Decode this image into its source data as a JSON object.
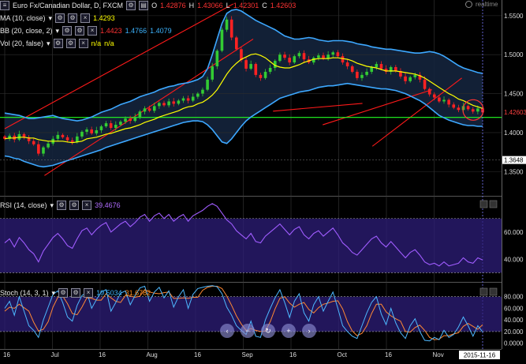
{
  "header": {
    "symbol": "Euro Fx/Canadian Dollar, D, FXCM",
    "o_label": "O",
    "o_value": "1.42876",
    "h_label": "H",
    "h_value": "1.43066",
    "l_label": "L",
    "l_value": "1.42301",
    "c_label": "C",
    "c_value": "1.42603",
    "realtime_label": "realtime"
  },
  "indicators": {
    "ma": {
      "label": "MA (10, close)",
      "value": "1.4293"
    },
    "bb": {
      "label": "BB (20, close, 2)",
      "v1": "1.4423",
      "v2": "1.4766",
      "v3": "1.4079"
    },
    "vol": {
      "label": "Vol (20, false)",
      "v1": "n/a",
      "v2": "n/a"
    },
    "rsi": {
      "label": "RSI (14, close)",
      "value": "39.4676"
    },
    "stoch": {
      "label": "Stoch (14, 3, 1)",
      "v1": "19.5034",
      "v2": "31.6782"
    }
  },
  "colors": {
    "background": "#000000",
    "up_candle": "#33cc33",
    "down_candle": "#ff2222",
    "ma": "#ffff00",
    "band": "#3da8ff",
    "band_fill": "#14243c",
    "trend": "#ff1a1a",
    "support": "#22ff22",
    "rsi": "#a05cff",
    "stoch_k": "#4db8ff",
    "stoch_d": "#ff8833",
    "panel_fill": "#2e1e7a"
  },
  "chart_data": [
    {
      "type": "candlestick",
      "title": "Euro Fx/Canadian Dollar, D, FXCM",
      "y_ticks": [
        "1.5500",
        "1.5000",
        "1.4500",
        "1.4000",
        "1.3500"
      ],
      "ylim": [
        1.33,
        1.56
      ],
      "last_price_label": "1.42603",
      "last_price": 1.42603,
      "support_label": "1.3648",
      "support": 1.3648,
      "x_ticks": [
        "16",
        "Jul",
        "16",
        "Aug",
        "16",
        "Sep",
        "16",
        "Oct",
        "16",
        "Nov"
      ],
      "x_tick_dates": [
        "2015-06-16",
        "2015-07-01",
        "2015-07-16",
        "2015-08-01",
        "2015-08-16",
        "2015-09-01",
        "2015-09-16",
        "2015-10-01",
        "2015-10-16",
        "2015-11-01"
      ],
      "cursor_date_label": "2015-11-16",
      "close": [
        1.392,
        1.396,
        1.391,
        1.398,
        1.394,
        1.389,
        1.385,
        1.373,
        1.381,
        1.386,
        1.392,
        1.397,
        1.394,
        1.39,
        1.388,
        1.395,
        1.401,
        1.404,
        1.399,
        1.403,
        1.408,
        1.412,
        1.406,
        1.41,
        1.414,
        1.418,
        1.415,
        1.42,
        1.427,
        1.431,
        1.428,
        1.434,
        1.438,
        1.435,
        1.44,
        1.437,
        1.441,
        1.444,
        1.441,
        1.446,
        1.45,
        1.455,
        1.468,
        1.485,
        1.505,
        1.532,
        1.545,
        1.522,
        1.507,
        1.493,
        1.482,
        1.488,
        1.474,
        1.47,
        1.478,
        1.483,
        1.492,
        1.5,
        1.496,
        1.49,
        1.498,
        1.502,
        1.494,
        1.49,
        1.496,
        1.499,
        1.495,
        1.5,
        1.503,
        1.498,
        1.49,
        1.485,
        1.478,
        1.47,
        1.474,
        1.478,
        1.484,
        1.488,
        1.482,
        1.478,
        1.484,
        1.479,
        1.472,
        1.466,
        1.471,
        1.474,
        1.468,
        1.456,
        1.449,
        1.445,
        1.44,
        1.442,
        1.436,
        1.432,
        1.429,
        1.434,
        1.43,
        1.427,
        1.431,
        1.426
      ],
      "ma": [
        1.392,
        1.393,
        1.393,
        1.394,
        1.394,
        1.393,
        1.393,
        1.391,
        1.39,
        1.389,
        1.389,
        1.389,
        1.389,
        1.388,
        1.387,
        1.388,
        1.389,
        1.392,
        1.393,
        1.394,
        1.396,
        1.398,
        1.399,
        1.401,
        1.403,
        1.405,
        1.406,
        1.408,
        1.41,
        1.413,
        1.415,
        1.417,
        1.42,
        1.422,
        1.424,
        1.426,
        1.428,
        1.431,
        1.433,
        1.434,
        1.437,
        1.439,
        1.443,
        1.448,
        1.455,
        1.465,
        1.475,
        1.483,
        1.489,
        1.494,
        1.497,
        1.5,
        1.501,
        1.499,
        1.496,
        1.491,
        1.486,
        1.484,
        1.483,
        1.483,
        1.485,
        1.487,
        1.49,
        1.492,
        1.494,
        1.495,
        1.495,
        1.495,
        1.496,
        1.496,
        1.495,
        1.494,
        1.492,
        1.489,
        1.487,
        1.485,
        1.484,
        1.483,
        1.481,
        1.479,
        1.479,
        1.479,
        1.478,
        1.477,
        1.476,
        1.475,
        1.473,
        1.47,
        1.466,
        1.462,
        1.458,
        1.454,
        1.45,
        1.447,
        1.443,
        1.441,
        1.438,
        1.435,
        1.433,
        1.431
      ],
      "bb_upper": [
        1.425,
        1.424,
        1.423,
        1.422,
        1.42,
        1.418,
        1.418,
        1.419,
        1.42,
        1.421,
        1.422,
        1.42,
        1.418,
        1.417,
        1.416,
        1.415,
        1.416,
        1.418,
        1.42,
        1.423,
        1.426,
        1.428,
        1.43,
        1.433,
        1.436,
        1.438,
        1.44,
        1.443,
        1.446,
        1.448,
        1.45,
        1.452,
        1.455,
        1.457,
        1.459,
        1.46,
        1.462,
        1.463,
        1.464,
        1.466,
        1.468,
        1.472,
        1.482,
        1.5,
        1.52,
        1.54,
        1.553,
        1.557,
        1.558,
        1.556,
        1.552,
        1.548,
        1.544,
        1.541,
        1.538,
        1.535,
        1.532,
        1.528,
        1.524,
        1.522,
        1.52,
        1.52,
        1.521,
        1.522,
        1.521,
        1.519,
        1.518,
        1.517,
        1.518,
        1.518,
        1.518,
        1.517,
        1.516,
        1.514,
        1.513,
        1.512,
        1.51,
        1.509,
        1.508,
        1.507,
        1.507,
        1.506,
        1.505,
        1.504,
        1.503,
        1.502,
        1.502,
        1.503,
        1.504,
        1.503,
        1.501,
        1.498,
        1.494,
        1.49,
        1.486,
        1.483,
        1.481,
        1.479,
        1.477,
        1.476
      ],
      "bb_lower": [
        1.37,
        1.369,
        1.367,
        1.366,
        1.363,
        1.361,
        1.359,
        1.357,
        1.356,
        1.357,
        1.358,
        1.36,
        1.362,
        1.364,
        1.366,
        1.368,
        1.37,
        1.372,
        1.374,
        1.376,
        1.378,
        1.381,
        1.383,
        1.385,
        1.387,
        1.389,
        1.391,
        1.393,
        1.395,
        1.397,
        1.399,
        1.401,
        1.403,
        1.405,
        1.407,
        1.409,
        1.411,
        1.413,
        1.414,
        1.415,
        1.415,
        1.414,
        1.41,
        1.404,
        1.396,
        1.388,
        1.386,
        1.392,
        1.4,
        1.408,
        1.415,
        1.42,
        1.424,
        1.428,
        1.432,
        1.436,
        1.44,
        1.444,
        1.446,
        1.448,
        1.45,
        1.452,
        1.453,
        1.454,
        1.456,
        1.458,
        1.459,
        1.46,
        1.46,
        1.461,
        1.462,
        1.463,
        1.462,
        1.461,
        1.46,
        1.459,
        1.458,
        1.457,
        1.456,
        1.456,
        1.455,
        1.454,
        1.452,
        1.45,
        1.447,
        1.444,
        1.441,
        1.437,
        1.432,
        1.427,
        1.422,
        1.419,
        1.416,
        1.414,
        1.412,
        1.41,
        1.409,
        1.409,
        1.408,
        1.408
      ]
    },
    {
      "type": "line",
      "title": "RSI (14, close)",
      "y_ticks": [
        "60.000",
        "40.000"
      ],
      "ylim": [
        25,
        85
      ],
      "upper_band": 70,
      "lower_band": 30,
      "series": [
        {
          "name": "RSI (14, close)",
          "values": [
            52,
            55,
            49,
            56,
            52,
            47,
            44,
            38,
            46,
            51,
            56,
            59,
            55,
            50,
            48,
            55,
            61,
            63,
            58,
            62,
            65,
            67,
            60,
            63,
            66,
            68,
            64,
            67,
            71,
            73,
            68,
            72,
            74,
            70,
            73,
            68,
            71,
            73,
            68,
            72,
            74,
            76,
            79,
            81,
            79,
            74,
            69,
            66,
            61,
            58,
            55,
            59,
            53,
            52,
            57,
            60,
            63,
            66,
            62,
            58,
            62,
            64,
            58,
            55,
            59,
            61,
            57,
            60,
            63,
            58,
            52,
            49,
            45,
            43,
            47,
            51,
            55,
            57,
            52,
            49,
            53,
            49,
            45,
            41,
            45,
            47,
            43,
            38,
            36,
            37,
            35,
            38,
            35,
            36,
            37,
            41,
            38,
            37,
            41,
            39.4676
          ]
        }
      ]
    },
    {
      "type": "line",
      "title": "Stoch (14, 3, 1)",
      "y_ticks": [
        "80.000",
        "60.000",
        "40.000",
        "20.000",
        "0.0000"
      ],
      "ylim": [
        -10,
        100
      ],
      "upper_band": 80,
      "lower_band": 20,
      "series": [
        {
          "name": "%K",
          "values": [
            60,
            72,
            48,
            80,
            55,
            30,
            22,
            10,
            40,
            62,
            84,
            90,
            70,
            45,
            38,
            65,
            82,
            88,
            60,
            75,
            88,
            92,
            55,
            70,
            86,
            90,
            66,
            82,
            95,
            98,
            72,
            88,
            96,
            78,
            90,
            62,
            80,
            92,
            60,
            84,
            94,
            96,
            98,
            99,
            97,
            85,
            62,
            48,
            30,
            22,
            15,
            38,
            12,
            10,
            40,
            60,
            78,
            92,
            70,
            44,
            72,
            85,
            52,
            38,
            66,
            80,
            55,
            72,
            88,
            60,
            30,
            20,
            12,
            8,
            30,
            52,
            70,
            80,
            50,
            32,
            60,
            35,
            18,
            8,
            30,
            42,
            20,
            5,
            4,
            10,
            6,
            22,
            10,
            15,
            28,
            45,
            30,
            12,
            30,
            19.5034
          ]
        },
        {
          "name": "%D",
          "values": [
            55,
            62,
            60,
            67,
            61,
            55,
            36,
            21,
            24,
            37,
            62,
            79,
            81,
            68,
            51,
            49,
            62,
            78,
            77,
            74,
            74,
            85,
            78,
            72,
            70,
            82,
            81,
            79,
            81,
            92,
            88,
            86,
            85,
            87,
            88,
            77,
            77,
            78,
            77,
            79,
            79,
            91,
            96,
            98,
            98,
            94,
            81,
            65,
            47,
            33,
            22,
            25,
            22,
            20,
            21,
            37,
            59,
            77,
            80,
            69,
            62,
            67,
            70,
            58,
            52,
            61,
            67,
            69,
            72,
            73,
            59,
            37,
            21,
            13,
            17,
            30,
            51,
            67,
            67,
            54,
            47,
            42,
            38,
            20,
            19,
            27,
            31,
            22,
            10,
            6,
            7,
            13,
            13,
            16,
            18,
            29,
            34,
            29,
            24,
            31.6782
          ]
        }
      ]
    }
  ],
  "nav_buttons": [
    "‹",
    "−",
    "↻",
    "+",
    "›"
  ]
}
